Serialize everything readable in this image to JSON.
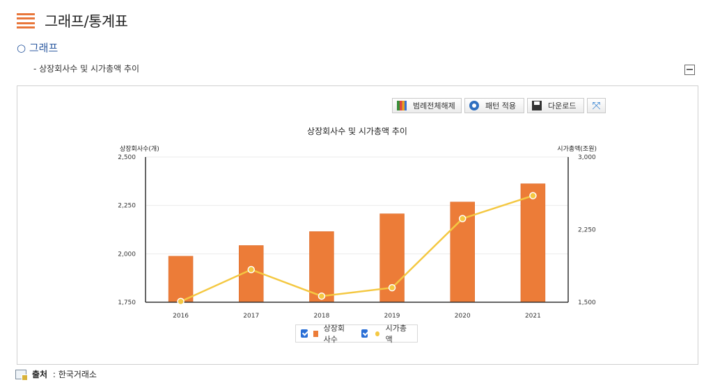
{
  "header": {
    "title": "그래프/통계표"
  },
  "section": {
    "label": "○ 그래프"
  },
  "subtitle": "- 상장회사수 및 시가총액 추이",
  "toolbar": {
    "legend_toggle_label": "범례전체해제",
    "pattern_label": "패턴 적용",
    "download_label": "다운로드"
  },
  "footer": {
    "source_label": "출처",
    "source_sep": " : ",
    "source_value": "한국거래소"
  },
  "colors": {
    "bar": "#ec7c38",
    "line": "#f4c842",
    "accent": "#e8763a",
    "link": "#2d5aa0"
  },
  "chart_data": {
    "type": "bar+line",
    "title": "상장회사수 및 시가총액 추이",
    "categories": [
      "2016",
      "2017",
      "2018",
      "2019",
      "2020",
      "2021"
    ],
    "series": [
      {
        "name": "상장회사수",
        "type": "bar",
        "axis": "left",
        "values": [
          1988,
          2043,
          2115,
          2207,
          2268,
          2362
        ]
      },
      {
        "name": "시가총액",
        "type": "line",
        "axis": "right",
        "values": [
          1508,
          1837,
          1563,
          1650,
          2364,
          2601
        ]
      }
    ],
    "y_left": {
      "label": "상장회사수(개)",
      "min": 1750,
      "max": 2500,
      "ticks": [
        1750,
        2000,
        2250,
        2500
      ],
      "tick_labels": [
        "1,750",
        "2,000",
        "2,250",
        "2,500"
      ]
    },
    "y_right": {
      "label": "시가총액(조원)",
      "min": 1500,
      "max": 3000,
      "ticks": [
        1500,
        2250,
        3000
      ],
      "tick_labels": [
        "1,500",
        "2,250",
        "3,000"
      ]
    },
    "grid": true,
    "legend": "bottom-center"
  }
}
